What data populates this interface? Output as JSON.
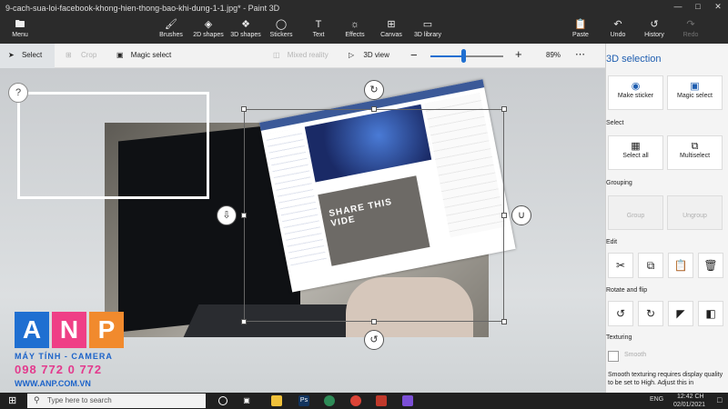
{
  "window": {
    "title": "9-cach-sua-loi-facebook-khong-hien-thong-bao-khi-dung-1-1.jpg* - Paint 3D"
  },
  "ribbon": {
    "menu": "Menu",
    "tools": [
      {
        "label": "Brushes",
        "icon": "brush-icon"
      },
      {
        "label": "2D shapes",
        "icon": "2d-shapes-icon"
      },
      {
        "label": "3D shapes",
        "icon": "3d-shapes-icon"
      },
      {
        "label": "Stickers",
        "icon": "stickers-icon"
      },
      {
        "label": "Text",
        "icon": "text-icon"
      },
      {
        "label": "Effects",
        "icon": "effects-icon"
      },
      {
        "label": "Canvas",
        "icon": "canvas-icon"
      },
      {
        "label": "3D library",
        "icon": "3d-library-icon"
      }
    ],
    "right": [
      {
        "label": "Paste",
        "icon": "paste-icon"
      },
      {
        "label": "Undo",
        "icon": "undo-icon"
      },
      {
        "label": "History",
        "icon": "history-icon"
      },
      {
        "label": "Redo",
        "icon": "redo-icon"
      }
    ]
  },
  "toolbar": {
    "select": "Select",
    "crop": "Crop",
    "magic_select": "Magic select",
    "mixed_reality": "Mixed reality",
    "view_3d": "3D view",
    "zoom": "89%",
    "zoom_level": 0.45,
    "more": "⋯"
  },
  "canvas": {
    "help": "?",
    "overlay_text": "SHARE THIS VIDE"
  },
  "watermark": {
    "letters": [
      "A",
      "N",
      "P"
    ],
    "colors": [
      "#1f6fd1",
      "#ef3f86",
      "#f18a2d"
    ],
    "line1": "MÁY TÍNH - CAMERA",
    "line2": "098 772 0 772",
    "line3": "WWW.ANP.COM.VN"
  },
  "panel": {
    "title": "3D selection",
    "make_sticker": "Make sticker",
    "magic_select": "Magic select",
    "select_section": "Select",
    "select_all": "Select all",
    "multiselect": "Multiselect",
    "grouping_section": "Grouping",
    "group": "Group",
    "ungroup": "Ungroup",
    "edit_section": "Edit",
    "rotate_section": "Rotate and flip",
    "texturing_section": "Texturing",
    "smooth": "Smooth",
    "smooth_note": "Smooth texturing requires display quality to be set to High. Adjust this in"
  },
  "taskbar": {
    "search_placeholder": "Type here to search",
    "time": "12:42 CH",
    "date": "02/01/2021",
    "language": "ENG",
    "apps": [
      {
        "icon": "task-view-icon",
        "color": "#202020"
      },
      {
        "icon": "file-explorer-icon",
        "color": "#f0c13a"
      },
      {
        "icon": "photoshop-icon",
        "color": "#12345e"
      },
      {
        "icon": "zalo-icon",
        "color": "#2e8b57"
      },
      {
        "icon": "chrome-icon",
        "color": "#db4437"
      },
      {
        "icon": "app-icon",
        "color": "#c0392b"
      },
      {
        "icon": "paint3d-icon",
        "color": "#7b4fd6"
      }
    ]
  }
}
